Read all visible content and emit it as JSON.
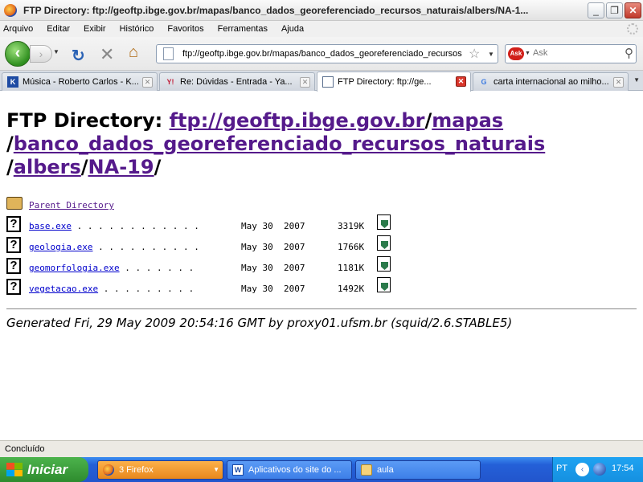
{
  "window": {
    "title": "FTP Directory: ftp://geoftp.ibge.gov.br/mapas/banco_dados_georeferenciado_recursos_naturais/albers/NA-1...",
    "minimize": "_",
    "maximize": "❐",
    "close": "✕"
  },
  "menu": [
    "Arquivo",
    "Editar",
    "Exibir",
    "Histórico",
    "Favoritos",
    "Ferramentas",
    "Ajuda"
  ],
  "navbar": {
    "url": "ftp://geoftp.ibge.gov.br/mapas/banco_dados_georeferenciado_recursos",
    "search_placeholder": "Ask",
    "search_provider_label": "Ask"
  },
  "tabs": [
    {
      "label": "Música - Roberto Carlos - K...",
      "favicon": "K",
      "favicon_color": "#1e4ba3",
      "active": false
    },
    {
      "label": "Re: Dúvidas - Entrada - Ya...",
      "favicon": "Y!",
      "favicon_color": "#c0203a",
      "active": false
    },
    {
      "label": "FTP Directory: ftp://ge...",
      "favicon": "page-icon",
      "favicon_color": "#5a6f8e",
      "active": true
    },
    {
      "label": "carta internacional ao milho...",
      "favicon": "G",
      "favicon_color": "#3d7be0",
      "active": false
    }
  ],
  "page": {
    "heading_prefix": "FTP Directory: ",
    "path_segments": [
      {
        "text": "ftp://geoftp.ibge.gov.br",
        "sep_after": "/"
      },
      {
        "text": "mapas",
        "sep_after": " /"
      },
      {
        "text": "banco_dados_georeferenciado_recursos_naturais",
        "sep_after": " /"
      },
      {
        "text": "albers",
        "sep_after": "/"
      },
      {
        "text": "NA-19",
        "sep_after": "/"
      }
    ],
    "parent_directory": "Parent Directory",
    "files": [
      {
        "name": "base.exe",
        "dots": "         . . . . . . . . . . . . ",
        "date": "May 30  2007",
        "size": "3319K"
      },
      {
        "name": "geologia.exe",
        "dots": "             . . . . . . . . . . ",
        "date": "May 30  2007",
        "size": "1766K"
      },
      {
        "name": "geomorfologia.exe",
        "dots": "                  . . . . . . . ",
        "date": "May 30  2007",
        "size": "1181K"
      },
      {
        "name": "vegetacao.exe",
        "dots": "              . . . . . . . . . ",
        "date": "May 30  2007",
        "size": "1492K"
      }
    ],
    "generated_note": "Generated Fri, 29 May 2009 20:54:16 GMT by proxy01.ufsm.br (squid/2.6.STABLE5)"
  },
  "status": "Concluído",
  "taskbar": {
    "start_label": "Iniciar",
    "tasks": [
      {
        "label": "3 Firefox",
        "icon": "firefox-icon",
        "active": true
      },
      {
        "label": "Aplicativos do site do ...",
        "icon": "word-icon",
        "active": false
      },
      {
        "label": "aula",
        "icon": "folder-icon",
        "active": false
      }
    ],
    "language": "PT",
    "clock": "17:54"
  }
}
